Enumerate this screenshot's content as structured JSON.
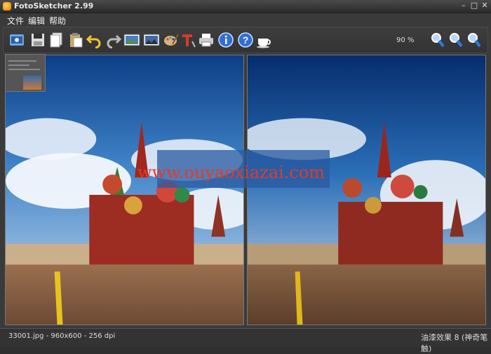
{
  "window": {
    "title": "FotoSketcher 2.99"
  },
  "menu": [
    "文件",
    "编辑",
    "帮助"
  ],
  "toolbar": {
    "buttons": [
      "open-image-icon",
      "save-icon",
      "copy-icon",
      "paste-icon",
      "undo-icon",
      "redo-icon",
      "original-image-icon",
      "result-image-icon",
      "paint-palette-icon",
      "text-icon",
      "print-icon",
      "info-icon",
      "help-icon",
      "coffee-icon"
    ],
    "zoom_level": "90 %",
    "zoom_buttons": [
      "zoom-in-icon",
      "zoom-fit-icon",
      "zoom-out-icon"
    ]
  },
  "watermark": {
    "text": "www.ouyaoxiazai.com"
  },
  "status": {
    "file_info": "33001.jpg - 960x600 - 256 dpi",
    "effect": "油漆效果 8 (神奇笔触)"
  },
  "colors": {
    "background": "#3a3a3a",
    "accent": "#e33a2a"
  }
}
